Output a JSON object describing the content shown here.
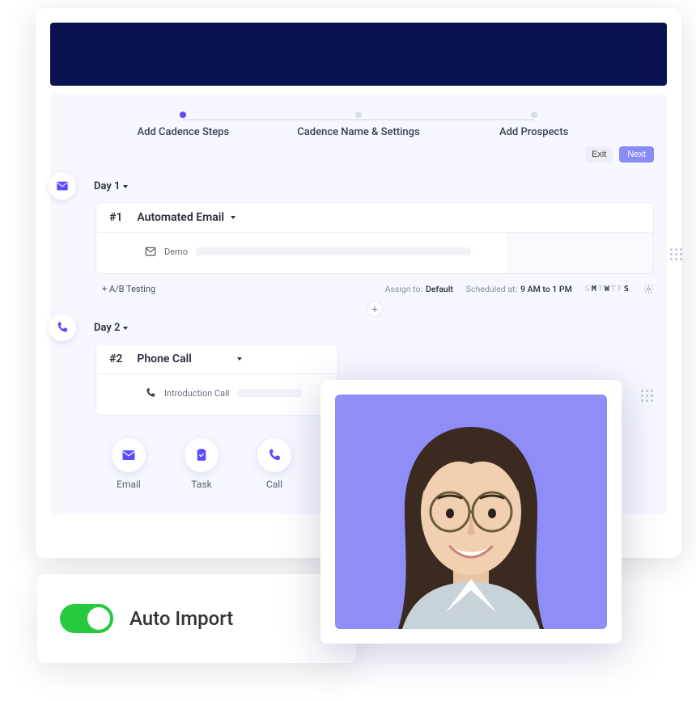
{
  "stepper": {
    "steps": [
      {
        "label": "Add Cadence Steps",
        "active": true
      },
      {
        "label": "Cadence Name & Settings",
        "active": false
      },
      {
        "label": "Add Prospects",
        "active": false
      }
    ],
    "exit_label": "Exit",
    "next_label": "Next"
  },
  "days": [
    {
      "label": "Day 1",
      "icon": "email",
      "step_num": "#1",
      "step_type": "Automated Email",
      "subject_label": "Demo",
      "footer": {
        "ab_label": "+ A/B Testing",
        "assign_key": "Assign to:",
        "assign_val": "Default",
        "sched_key": "Scheduled at:",
        "sched_val": "9 AM to 1 PM",
        "dow": [
          {
            "c": "S",
            "on": false
          },
          {
            "c": "M",
            "on": true
          },
          {
            "c": "T",
            "on": false
          },
          {
            "c": "W",
            "on": true
          },
          {
            "c": "T",
            "on": false
          },
          {
            "c": "F",
            "on": false
          },
          {
            "c": "S",
            "on": true
          }
        ]
      }
    },
    {
      "label": "Day 2",
      "icon": "phone",
      "step_num": "#2",
      "step_type": "Phone Call",
      "subject_label": "Introduction  Call"
    }
  ],
  "add_button": "+",
  "actions": [
    {
      "icon": "email",
      "label": "Email"
    },
    {
      "icon": "task",
      "label": "Task"
    },
    {
      "icon": "phone",
      "label": "Call"
    }
  ],
  "auto_import": {
    "label": "Auto Import",
    "enabled": true
  },
  "colors": {
    "accent": "#5b4bff",
    "navy": "#0a1251",
    "avatar_bg": "#8f8df8",
    "toggle_on": "#27c93f"
  }
}
